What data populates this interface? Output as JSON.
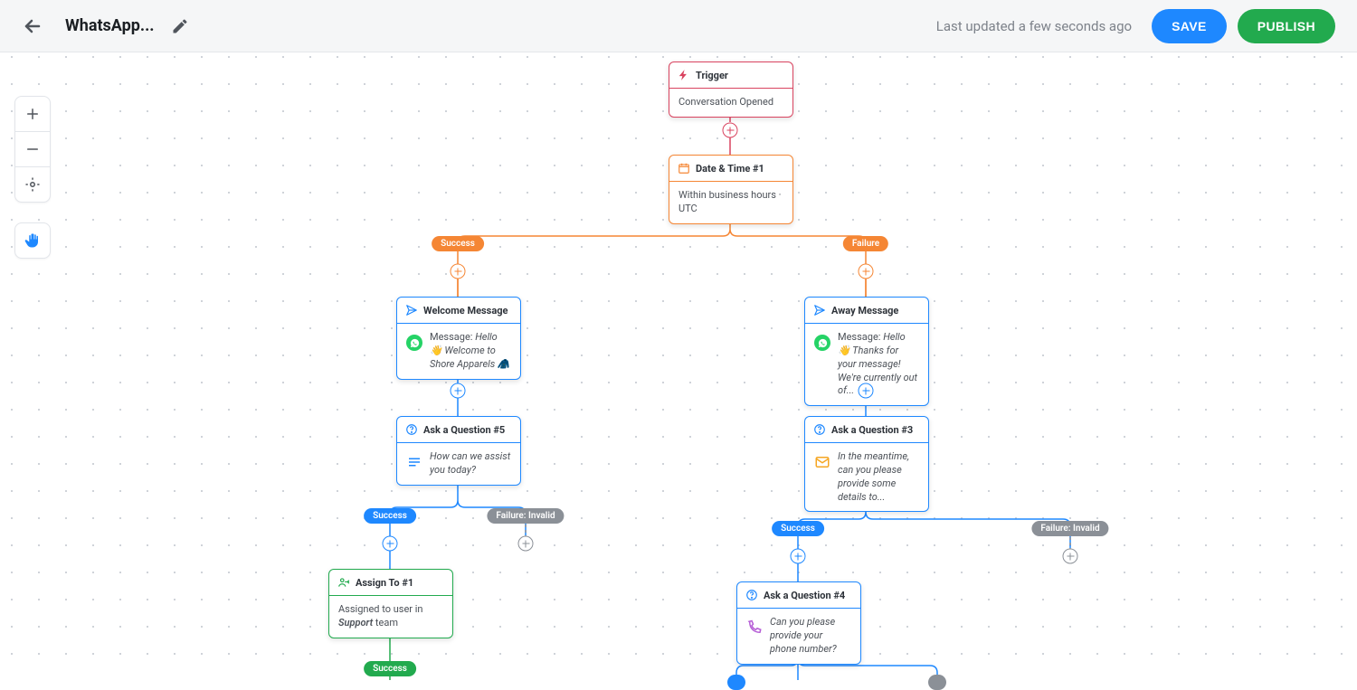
{
  "header": {
    "title": "WhatsApp...",
    "updated_text": "Last updated a few seconds ago",
    "save_label": "SAVE",
    "publish_label": "PUBLISH"
  },
  "nodes": {
    "trigger": {
      "title": "Trigger",
      "body": "Conversation Opened"
    },
    "datetime": {
      "title": "Date & Time #1",
      "body": "Within business hours · UTC"
    },
    "welcome": {
      "title": "Welcome Message",
      "msg_label": "Message: ",
      "msg_value": "Hello 👋 Welcome to Shore Apparels 🧥"
    },
    "away": {
      "title": "Away Message",
      "msg_label": "Message: ",
      "msg_value": "Hello 👋 Thanks for your message! We're currently out of..."
    },
    "askq5": {
      "title": "Ask a Question #5",
      "body": "How can we assist you today?"
    },
    "askq3": {
      "title": "Ask a Question #3",
      "body": "In the meantime, can you please provide some details to..."
    },
    "assign1": {
      "title": "Assign To #1",
      "body_pre": "Assigned to user in ",
      "body_em": "Support",
      "body_post": " team"
    },
    "askq4": {
      "title": "Ask a Question #4",
      "body": "Can you please provide your phone number?"
    }
  },
  "pills": {
    "success": "Success",
    "failure": "Failure",
    "failure_invalid": "Failure: Invalid"
  },
  "colors": {
    "red": "#d9435f",
    "orange": "#f58634",
    "blue": "#1e88ff",
    "green": "#22aa4e",
    "grey": "#8b9097"
  }
}
